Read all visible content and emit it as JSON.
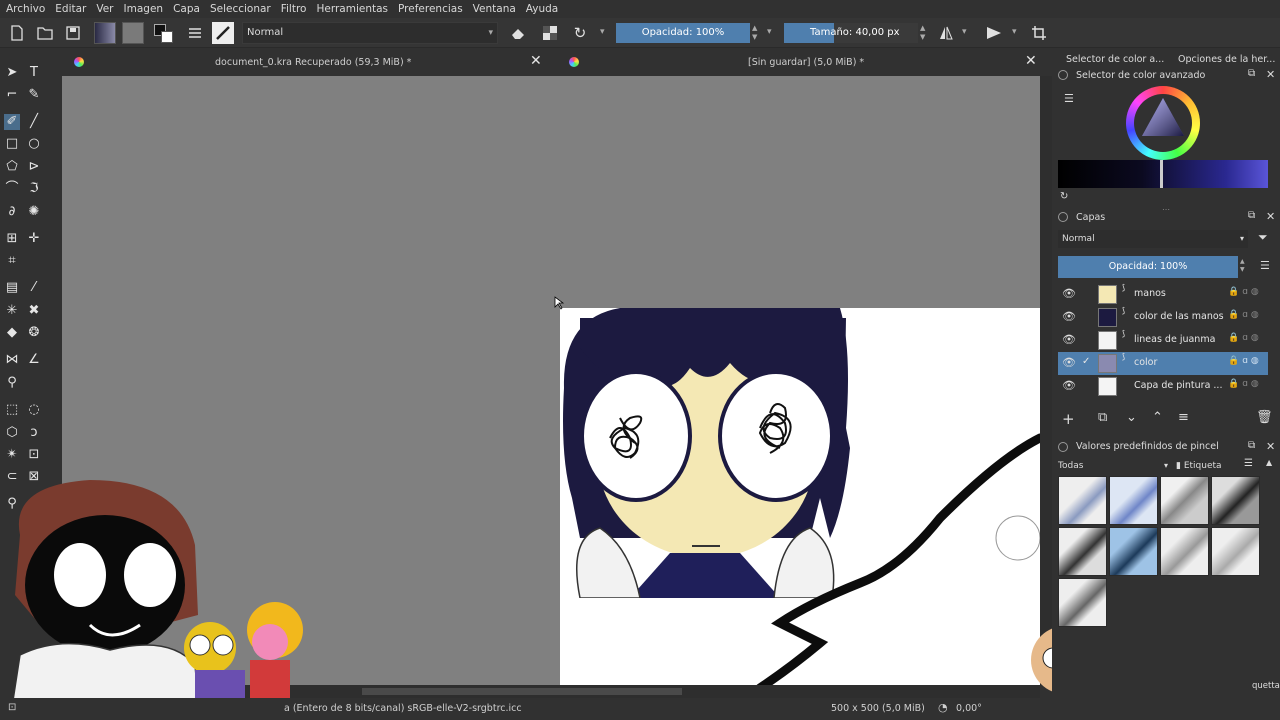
{
  "menu": [
    "Archivo",
    "Editar",
    "Ver",
    "Imagen",
    "Capa",
    "Seleccionar",
    "Filtro",
    "Herramientas",
    "Preferencias",
    "Ventana",
    "Ayuda"
  ],
  "toolbar": {
    "blend_mode": "Normal",
    "opacity_label": "Opacidad: 100%",
    "size_label": "Tamaño: 40,00 px",
    "opacity_fraction": 1.0
  },
  "tabs": [
    {
      "title": "document_0.kra Recuperado (59,3 MiB) *"
    },
    {
      "title": "[Sin guardar] (5,0 MiB) *"
    }
  ],
  "dock": {
    "tab_color_selector": "Selector de color a...",
    "tab_tool_options": "Opciones de la her...",
    "advanced_color_title": "Selector de color avanzado",
    "layers_title": "Capas",
    "layers_blend": "Normal",
    "layers_opacity": "Opacidad:  100%",
    "layers": [
      {
        "name": "manos",
        "selected": false
      },
      {
        "name": "color de las manos",
        "selected": false
      },
      {
        "name": "lineas de juanma",
        "selected": false
      },
      {
        "name": "color",
        "selected": true
      },
      {
        "name": "Capa de pintura ...",
        "selected": false
      }
    ],
    "brush_presets_title": "Valores predefinidos de pincel",
    "brush_filter": "Todas",
    "brush_tag_label": "Etiqueta",
    "brush_tag_bottom": "quetta"
  },
  "statusbar": {
    "color_profile": "a (Entero de 8 bits/canal)  sRGB-elle-V2-srgbtrc.icc",
    "image_size": "500 x 500 (5,0 MiB)",
    "rotation": "0,00°"
  },
  "colors": {
    "accent": "#4f7fae",
    "background": "#313131",
    "canvas_bg": "#808080",
    "hair": "#1c1a40",
    "skin": "#f4e8b4"
  },
  "icons": [
    "new-document-icon",
    "open-icon",
    "save-icon",
    "gradient-icon",
    "pattern-icon",
    "fg-bg-color-icon",
    "brush-settings-icon",
    "brush-preset-icon",
    "eraser-icon",
    "alpha-lock-icon",
    "reload-icon",
    "mirror-horizontal-icon",
    "mirror-vertical-icon",
    "wrap-icon"
  ]
}
